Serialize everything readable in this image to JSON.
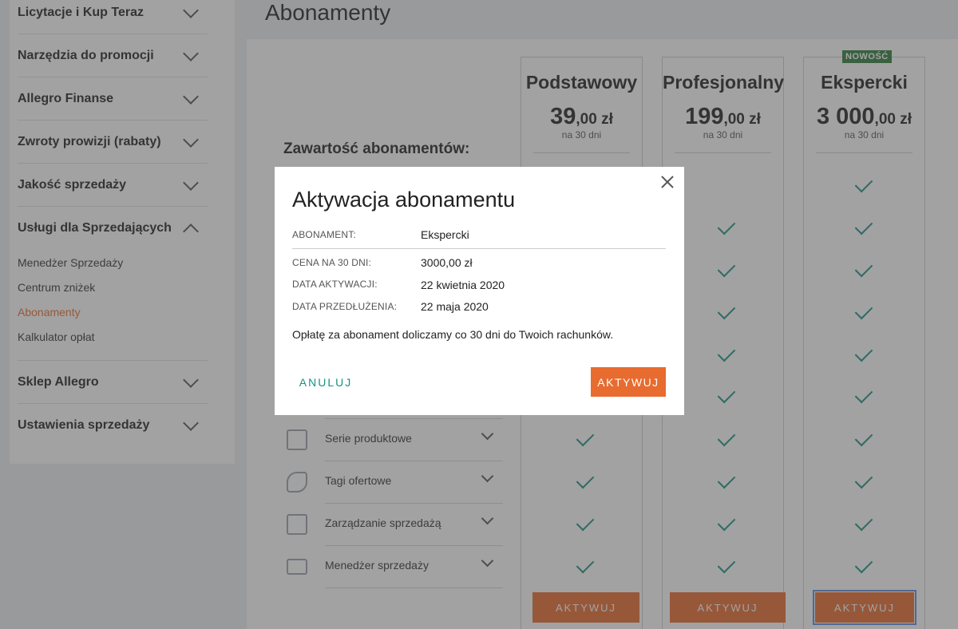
{
  "sidebar": {
    "groups": [
      {
        "label": "Licytacje i Kup Teraz"
      },
      {
        "label": "Narzędzia do promocji"
      },
      {
        "label": "Allegro Finanse"
      },
      {
        "label": "Zwroty prowizji (rabaty)"
      },
      {
        "label": "Jakość sprzedaży"
      },
      {
        "label": "Usługi dla Sprzedających"
      },
      {
        "label": "Sklep Allegro"
      },
      {
        "label": "Ustawienia sprzedaży"
      }
    ],
    "sub_items": [
      {
        "label": "Menedżer Sprzedaży"
      },
      {
        "label": "Centrum zniżek"
      },
      {
        "label": "Abonamenty",
        "active": true
      },
      {
        "label": "Kalkulator opłat"
      }
    ]
  },
  "page": {
    "title": "Abonamenty",
    "contents_heading": "Zawartość abonamentów:"
  },
  "plans": [
    {
      "name": "Podstawowy",
      "price_main": "39",
      "price_decimal": ",00 zł",
      "period": "na 30 dni",
      "button": "AKTYWUJ"
    },
    {
      "name": "Profesjonalny",
      "price_main": "199",
      "price_decimal": ",00 zł",
      "period": "na 30 dni",
      "button": "AKTYWUJ"
    },
    {
      "name": "Ekspercki",
      "price_main": "3 000",
      "price_decimal": ",00 zł",
      "period": "na 30 dni",
      "button": "AKTYWUJ",
      "badge": "NOWOŚĆ"
    }
  ],
  "features": [
    {
      "label": "Serie produktowe",
      "icon": "bags-icon"
    },
    {
      "label": "Tagi ofertowe",
      "icon": "tag-icon"
    },
    {
      "label": "Zarządzanie sprzedażą",
      "icon": "checklist-icon"
    },
    {
      "label": "Menedżer sprzedaży",
      "icon": "laptop-chart-icon"
    }
  ],
  "modal": {
    "title": "Aktywacja abonamentu",
    "rows": [
      {
        "label": "ABONAMENT:",
        "value": "Ekspercki"
      },
      {
        "label": "CENA NA 30 DNI:",
        "value": "3000,00 zł"
      },
      {
        "label": "DATA AKTYWACJI:",
        "value": "22 kwietnia 2020"
      },
      {
        "label": "DATA PRZEDŁUŻENIA:",
        "value": "22 maja 2020"
      }
    ],
    "note": "Opłatę za abonament doliczamy co 30 dni do Twoich rachunków.",
    "cancel_label": "ANULUJ",
    "activate_label": "AKTYWUJ"
  },
  "colors": {
    "accent": "#e86b2f",
    "check": "#1a9080",
    "badge": "#2d7d3a"
  }
}
